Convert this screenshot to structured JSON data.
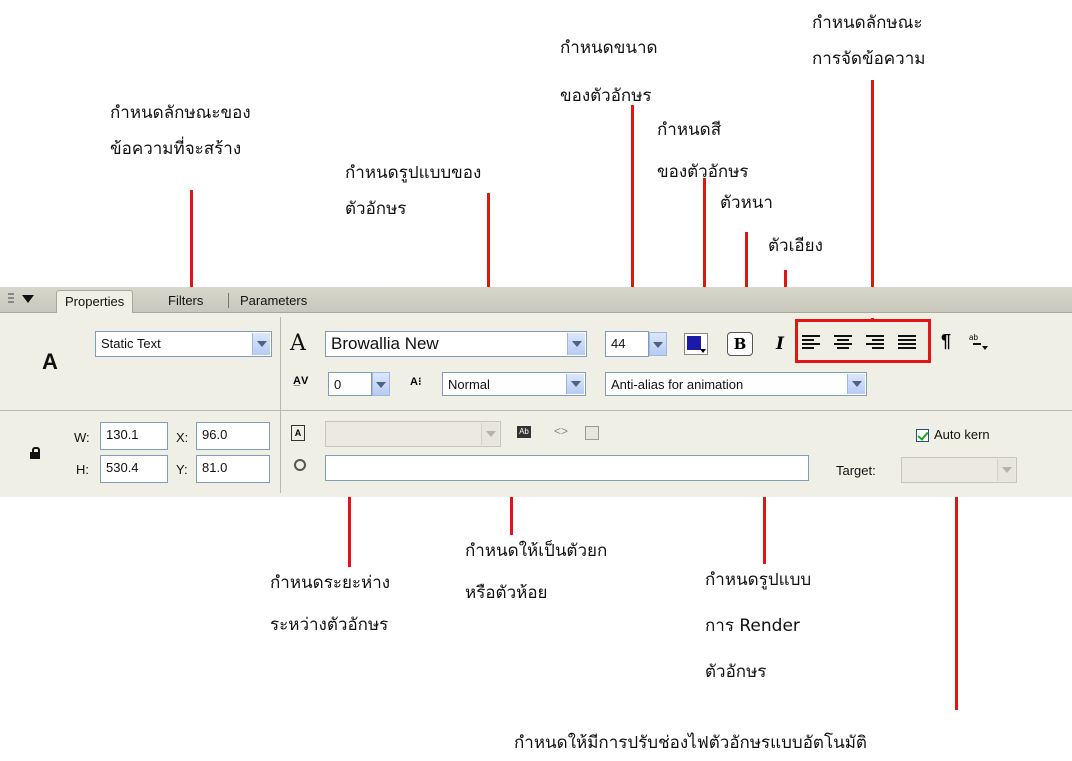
{
  "annotations": {
    "text_type": [
      "กำหนดลักษณะของ",
      "ข้อความที่จะสร้าง"
    ],
    "font_family": [
      "กำหนดรูปแบบของ",
      "ตัวอักษร"
    ],
    "font_size": [
      "กำหนดขนาด",
      "ของตัวอักษร"
    ],
    "font_color": [
      "กำหนดสี",
      "ของตัวอักษร"
    ],
    "bold": "ตัวหนา",
    "italic": "ตัวเอียง",
    "alignment": [
      "กำหนดลักษณะ",
      "การจัดข้อความ"
    ],
    "letter_spacing": [
      "กำหนดระยะห่าง",
      "ระหว่างตัวอักษร"
    ],
    "char_position": [
      "กำหนดให้เป็นตัวยก",
      "หรือตัวห้อย"
    ],
    "render": [
      "กำหนดรูปแบบ",
      "การ Render",
      "ตัวอักษร"
    ],
    "auto_kern": "กำหนดให้มีการปรับช่องไฟตัวอักษรแบบอัตโนมัติ"
  },
  "panel": {
    "tabs": [
      "Properties",
      "Filters",
      "Parameters"
    ],
    "tool_icon": "A",
    "text_type": "Static Text",
    "font_icon": "A",
    "font_family": "Browallia New",
    "font_size": "44",
    "font_color": "#1a1aa6",
    "bold_label": "B",
    "italic_label": "I",
    "paragraph_icon": "¶",
    "spacing_icon_label": "A̲V",
    "letter_spacing": "0",
    "position_icon_label": "A⁝",
    "char_position": "Normal",
    "render_mode": "Anti-alias for animation",
    "w_label": "W:",
    "w_value": "130.1",
    "x_label": "X:",
    "x_value": "96.0",
    "h_label": "H:",
    "h_value": "530.4",
    "y_label": "Y:",
    "y_value": "81.0",
    "auto_kern_label": "Auto kern",
    "auto_kern_checked": true,
    "target_label": "Target:",
    "url_value": "",
    "instance_value": ""
  }
}
